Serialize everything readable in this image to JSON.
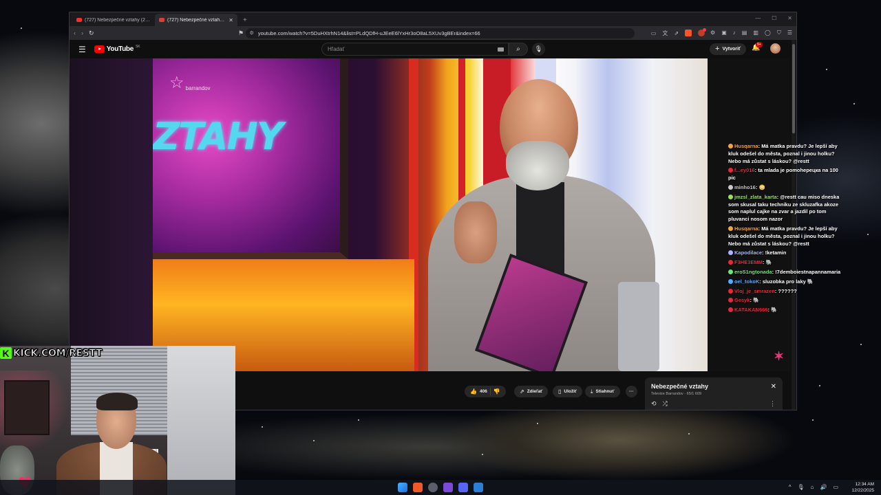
{
  "browser": {
    "tabs": [
      {
        "label": "(727) Nebezpečné vztahy (2025/13)",
        "active": false
      },
      {
        "label": "(727) Nebezpečné vztahy (20",
        "active": true
      }
    ],
    "new_tab": "+",
    "url": "youtube.com/watch?v=5DuHXtrhN14&list=PLdQDfH-uJEeE6lYxHr3oO8aL5XUv3gBEr&index=66"
  },
  "youtube": {
    "logo_text": "YouTube",
    "region": "SK",
    "search_placeholder": "Hľadať",
    "create_label": "Vytvoriť",
    "notif_count": "9+",
    "video_overlay": {
      "brand": "barrandov",
      "screen_text": "ZTAHY"
    },
    "actions": {
      "like_count": "406",
      "share": "Zdieľať",
      "save": "Uložiť",
      "download": "Stiahnuť",
      "more": "···"
    },
    "playlist": {
      "title": "Nebezpečné vztahy",
      "subtitle": "Televize Barrandov · 65/1 609"
    }
  },
  "stream_chat": [
    {
      "user": "Husqarna",
      "user_color": "#f3a43a",
      "text": "Má matka pravdu? Je lepší aby kluk odešel do města, poznal i jinou holku? Nebo má zůstat s láskou? @restt"
    },
    {
      "user": "f...ey016",
      "user_color": "#e5283c",
      "text": "ta mlada je pomohерецка na 100 pic"
    },
    {
      "user": "minho16",
      "user_color": "#c9c9c9",
      "text": "😳"
    },
    {
      "user": "jmzsl_zlata_karta",
      "user_color": "#9be15a",
      "text": "@restt cau miso dneska som skusal taku techniku ze skluzafka akoze som naplul cajke na zvar a jazdil po tom pluvanci nosom nazor"
    },
    {
      "user": "Husqarna",
      "user_color": "#f3a43a",
      "text": "Má matka pravdu? Je lepší aby kluk odešel do města, poznal i jinou holku? Nebo má zůstat s láskou? @restt"
    },
    {
      "user": "Kapodilace",
      "user_color": "#a9b6ff",
      "text": "!ketamin"
    },
    {
      "user": "F3HE3EMM",
      "user_color": "#e5283c",
      "text": "🐘"
    },
    {
      "user": "eroS1ngtonada",
      "user_color": "#6fe37a",
      "text": "!7demboiestnapannamaria"
    },
    {
      "user": "oel_tokoK",
      "user_color": "#5aa8ff",
      "text": "sluzobka pro laky 🐘"
    },
    {
      "user": "Vloj_je_smrazen",
      "user_color": "#e5283c",
      "text": "??????"
    },
    {
      "user": "Gesyk",
      "user_color": "#e5283c",
      "text": "🐘"
    },
    {
      "user": "KATAKAN666",
      "user_color": "#e5283c",
      "text": "🐘"
    }
  ],
  "stream": {
    "kick_url": "KICK.COM/RESTT"
  },
  "taskbar": {
    "time": "12:34 AM",
    "date": "12/22/2025"
  },
  "colors": {
    "youtube_red": "#ff0000",
    "kick_green": "#53fc18",
    "accent_pink": "#e83a7a"
  }
}
